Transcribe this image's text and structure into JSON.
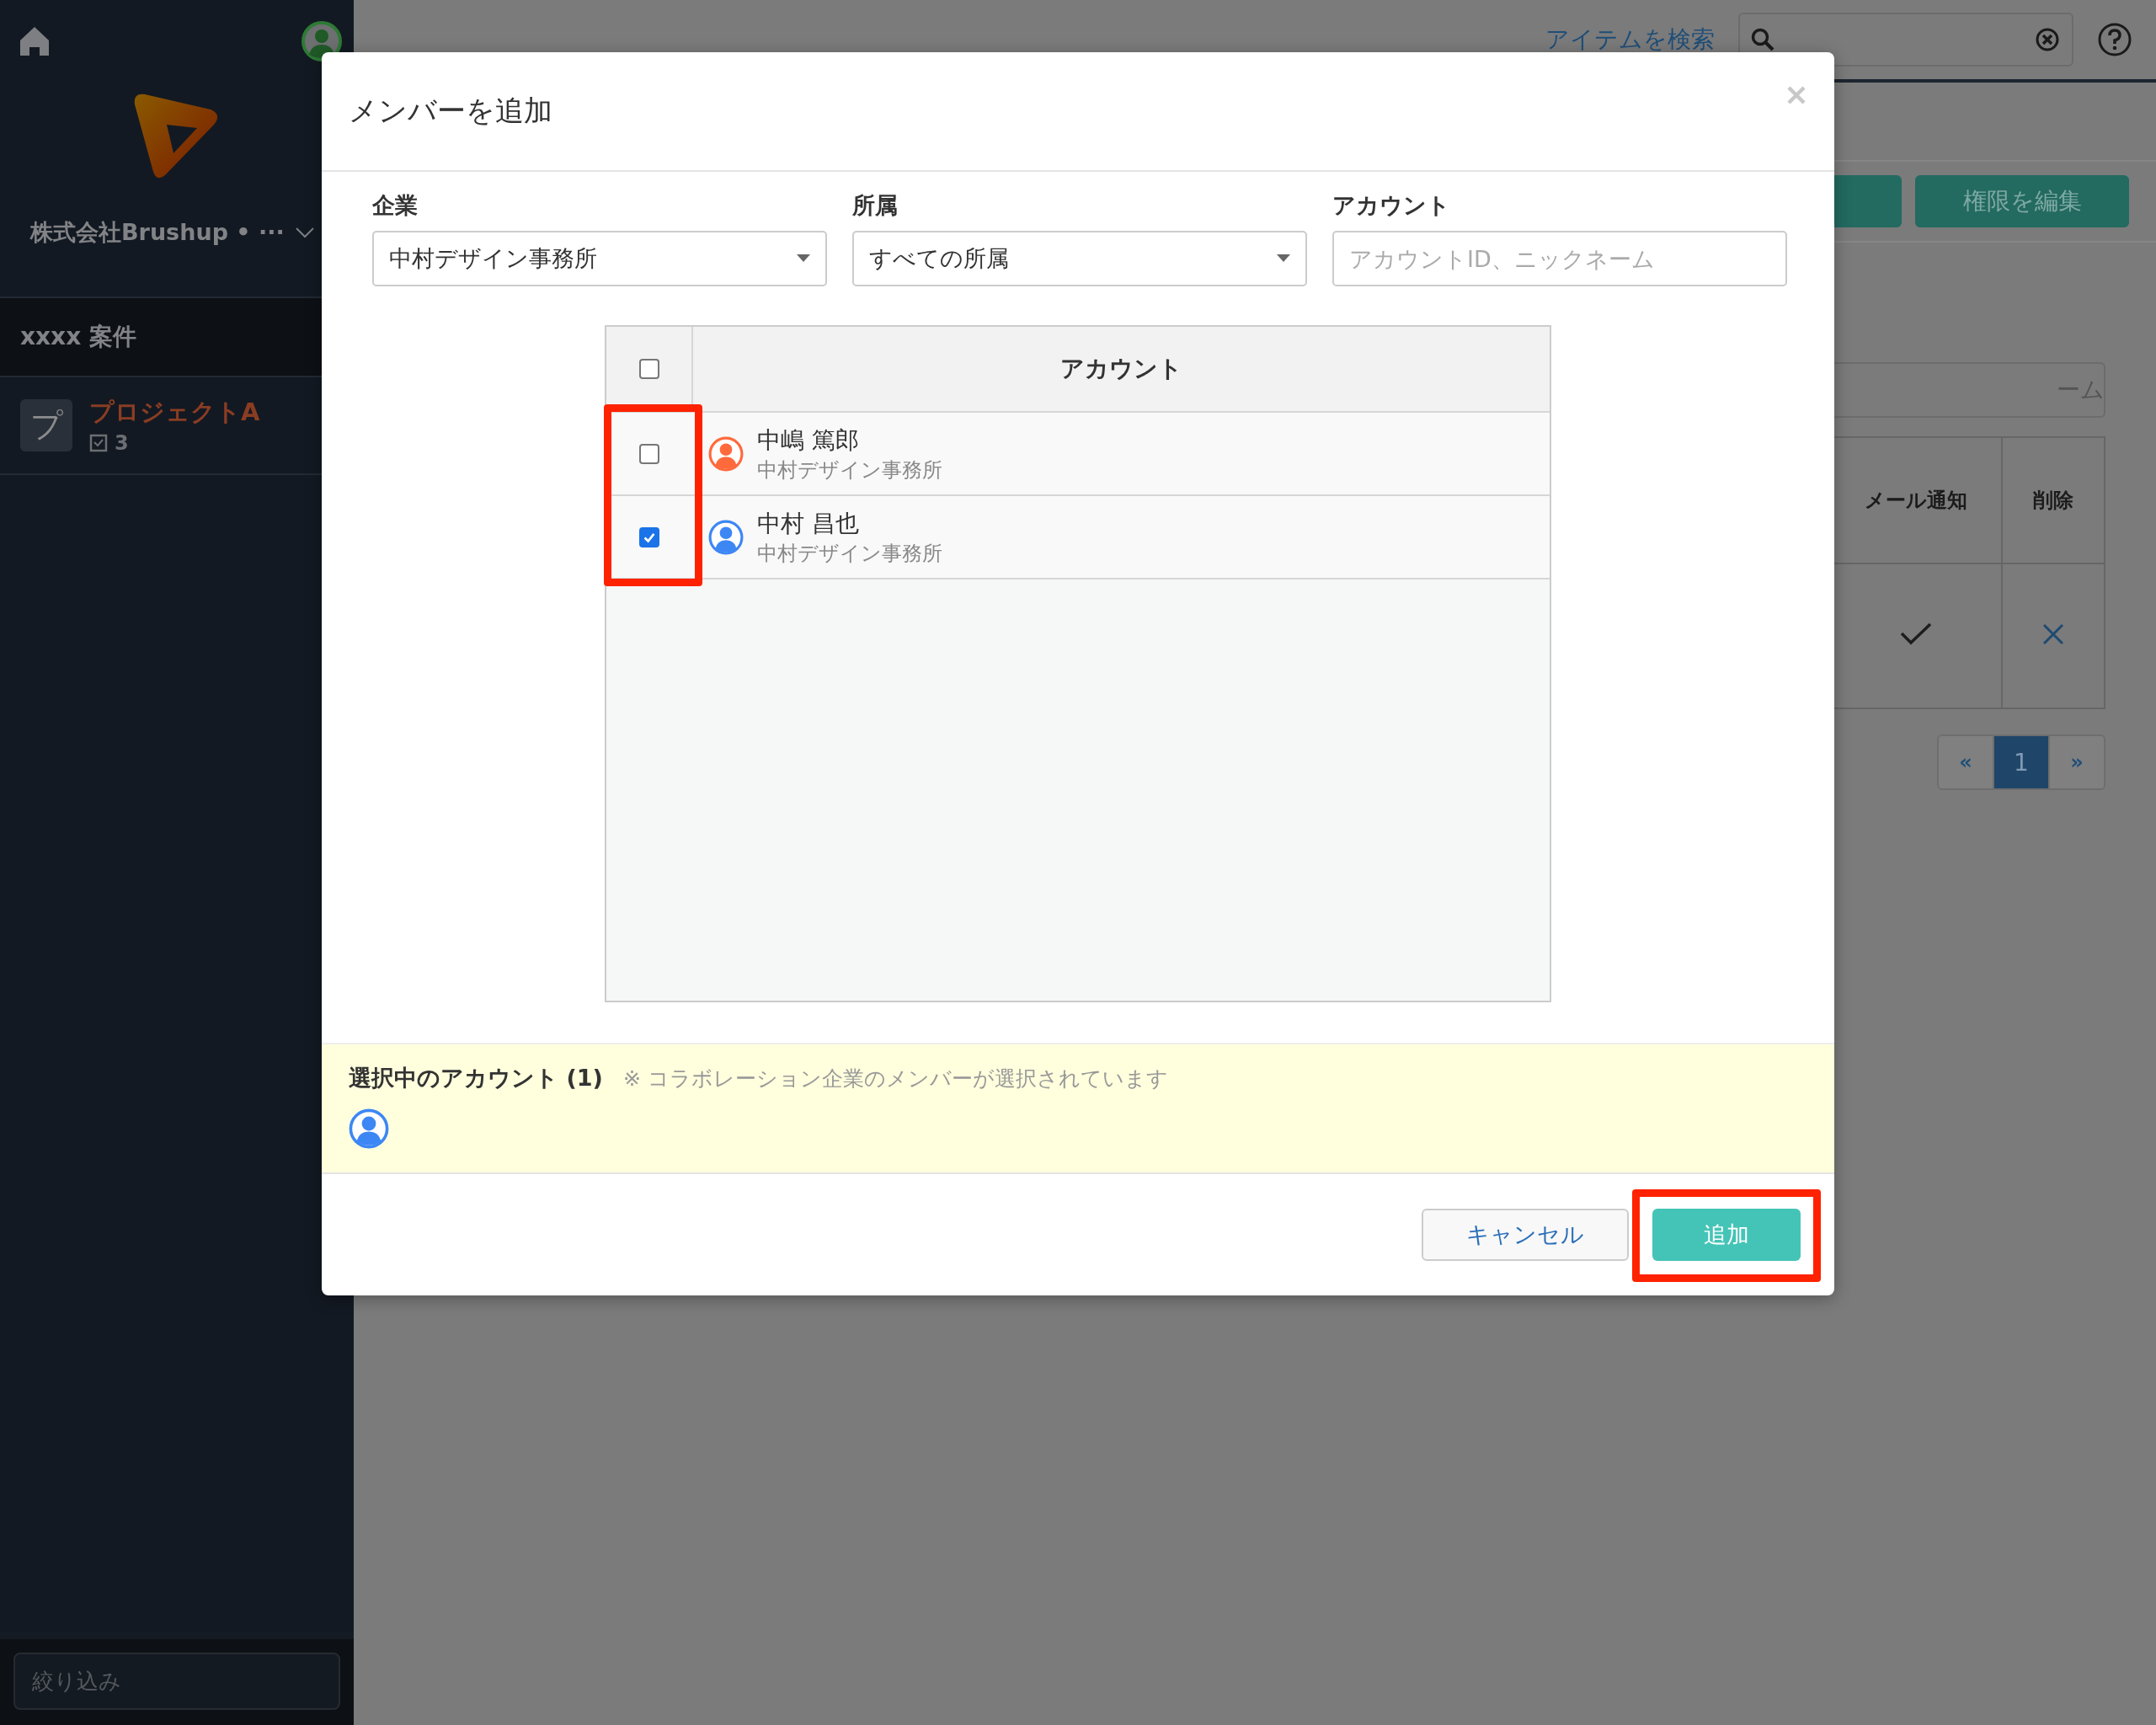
{
  "sidebar": {
    "company": "株式会社Brushup • ···",
    "section": "xxxx 案件",
    "projects": [
      {
        "initial": "プ",
        "name": "プロジェクトA",
        "count": "3"
      }
    ],
    "filter": {
      "placeholder": "絞り込み"
    }
  },
  "header": {
    "search_link": "アイテムを検索"
  },
  "background": {
    "buttons": [
      "権限を編集"
    ],
    "search_placeholder": "ーム",
    "table": {
      "columns": [
        "メール通知",
        "削除"
      ],
      "rows": [
        {
          "mail_notify": true
        }
      ]
    },
    "pagination": {
      "prev": "«",
      "pages": [
        {
          "label": "1",
          "selected": true
        }
      ],
      "next": "»"
    }
  },
  "modal": {
    "title": "メンバーを追加",
    "filters": [
      {
        "label": "企業",
        "kind": "select",
        "value": "中村デザイン事務所"
      },
      {
        "label": "所属",
        "kind": "select",
        "value": "すべての所属"
      },
      {
        "label": "アカウント",
        "kind": "text",
        "placeholder": "アカウントID、ニックネーム"
      }
    ],
    "table": {
      "all_checked": false,
      "column": "アカウント",
      "rows": [
        {
          "checked": false,
          "name": "中嶋 篤郎",
          "company": "中村デザイン事務所",
          "color": "#ff6a3d"
        },
        {
          "checked": true,
          "name": "中村 昌也",
          "company": "中村デザイン事務所",
          "color": "#3d87f5"
        }
      ]
    },
    "selection": {
      "title": "選択中のアカウント (1)",
      "note": "※ コラボレーション企業のメンバーが選択されています",
      "avatars": [
        {
          "color": "#3d87f5"
        }
      ]
    },
    "buttons": {
      "cancel": "キャンセル",
      "add": "追加"
    }
  }
}
